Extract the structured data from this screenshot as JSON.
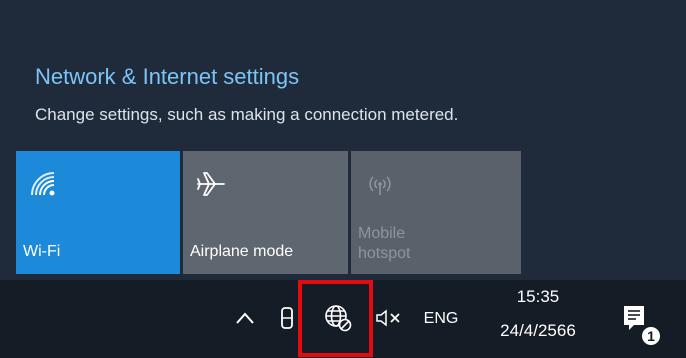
{
  "flyout": {
    "title": "Network & Internet settings",
    "subtitle": "Change settings, such as making a connection metered."
  },
  "quick_actions": [
    {
      "label": "Wi-Fi",
      "icon": "wifi-icon",
      "state": "on"
    },
    {
      "label": "Airplane mode",
      "icon": "airplane-icon",
      "state": "off"
    },
    {
      "label": "Mobile\nhotspot",
      "icon": "hotspot-icon",
      "state": "disabled"
    }
  ],
  "taskbar": {
    "language": "ENG",
    "time": "15:35",
    "date": "24/4/2566",
    "notification_count": "1",
    "icons": [
      "chevron-up-icon",
      "pen-icon",
      "network-globe-icon",
      "volume-muted-icon",
      "action-center-icon"
    ]
  },
  "colors": {
    "flyout_bg": "#1f2b3a",
    "accent": "#1c8ad8",
    "link": "#7cc4f5",
    "tile_off": "#5e6670",
    "taskbar_bg": "#141c25",
    "highlight": "#e50a12"
  }
}
